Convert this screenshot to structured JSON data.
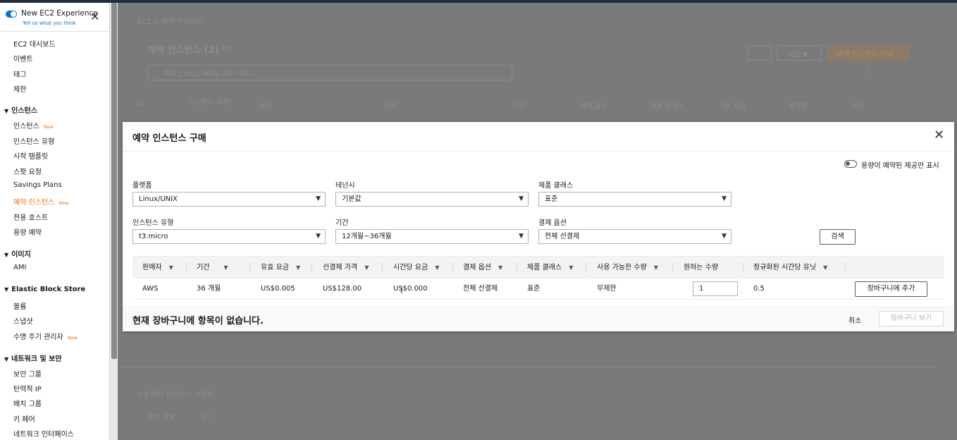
{
  "experience": {
    "title": "New EC2 Experience",
    "subtitle": "Tell us what you think"
  },
  "sidebar": {
    "top_items": [
      "EC2 대시보드",
      "이벤트",
      "태그",
      "제한"
    ],
    "sections": [
      {
        "title": "인스턴스",
        "items": [
          "인스턴스",
          "인스턴스 유형",
          "시작 템플릿",
          "스팟 요청",
          "Savings Plans",
          "예약 인스턴스",
          "전용 호스트",
          "용량 예약"
        ]
      },
      {
        "title": "이미지",
        "items": [
          "AMI"
        ]
      },
      {
        "title": "Elastic Block Store",
        "items": [
          "볼륨",
          "스냅샷",
          "수명 주기 관리자"
        ]
      },
      {
        "title": "네트워크 및 보안",
        "items": [
          "보안 그룹",
          "탄력적 IP",
          "배치 그룹",
          "키 페어",
          "네트워크 인터페이스"
        ]
      }
    ],
    "new_badge": "New"
  },
  "background": {
    "breadcrumb": "EC2 > 예약 인스턴스",
    "page_title": "예약 인스턴스 (2)",
    "info": "정보",
    "search_placeholder": "예약 인스턴스 필터링 검색 기준 ...",
    "actions_label": "작업 ▼",
    "purchase_label": "예약 인스턴스 구매",
    "page_number": "1",
    "columns": [
      "ID",
      "인스턴스 유형",
      "범위",
      "만료",
      "기간",
      "결제 옵션",
      "제품 클래스",
      "기본 요금",
      "플랫폼",
      "상태"
    ],
    "selected_text": "1개 예약 인스턴스 선택됨",
    "tabs": [
      "예약 정보",
      "태그"
    ]
  },
  "modal": {
    "title": "예약 인스턴스 구매",
    "capacity_toggle_label": "용량이 예약된 제공만 표시",
    "filters": {
      "platform": {
        "label": "플랫폼",
        "value": "Linux/UNIX"
      },
      "tenancy": {
        "label": "테넌시",
        "value": "기본값"
      },
      "offering_class": {
        "label": "제품 클래스",
        "value": "표준"
      },
      "instance_type": {
        "label": "인스턴스 유형",
        "value": "t3.micro"
      },
      "term": {
        "label": "기간",
        "value": "12개월~36개월"
      },
      "payment_option": {
        "label": "결제 옵션",
        "value": "전체 선결제"
      }
    },
    "search_button": "검색",
    "table": {
      "headers": [
        "판매자",
        "기간",
        "유효 요금",
        "선결제 가격",
        "시간당 요금",
        "결제 옵션",
        "제품 클래스",
        "사용 가능한 수량",
        "원하는 수량",
        "정규화된 시간당 유닛"
      ],
      "row": {
        "seller": "AWS",
        "term": "36 개월",
        "effective_rate": "US$0.005",
        "upfront_price": "US$128.00",
        "hourly_rate": "US$0.000",
        "payment_option": "전체 선결제",
        "offering_class": "표준",
        "available_quantity": "무제한",
        "desired_quantity": "1",
        "normalized_units": "0.5",
        "add_to_cart": "장바구니에 추가"
      }
    },
    "cart_message": "현재 장바구니에 항목이 없습니다.",
    "cancel": "취소",
    "view_cart": "장바구니 보기"
  }
}
